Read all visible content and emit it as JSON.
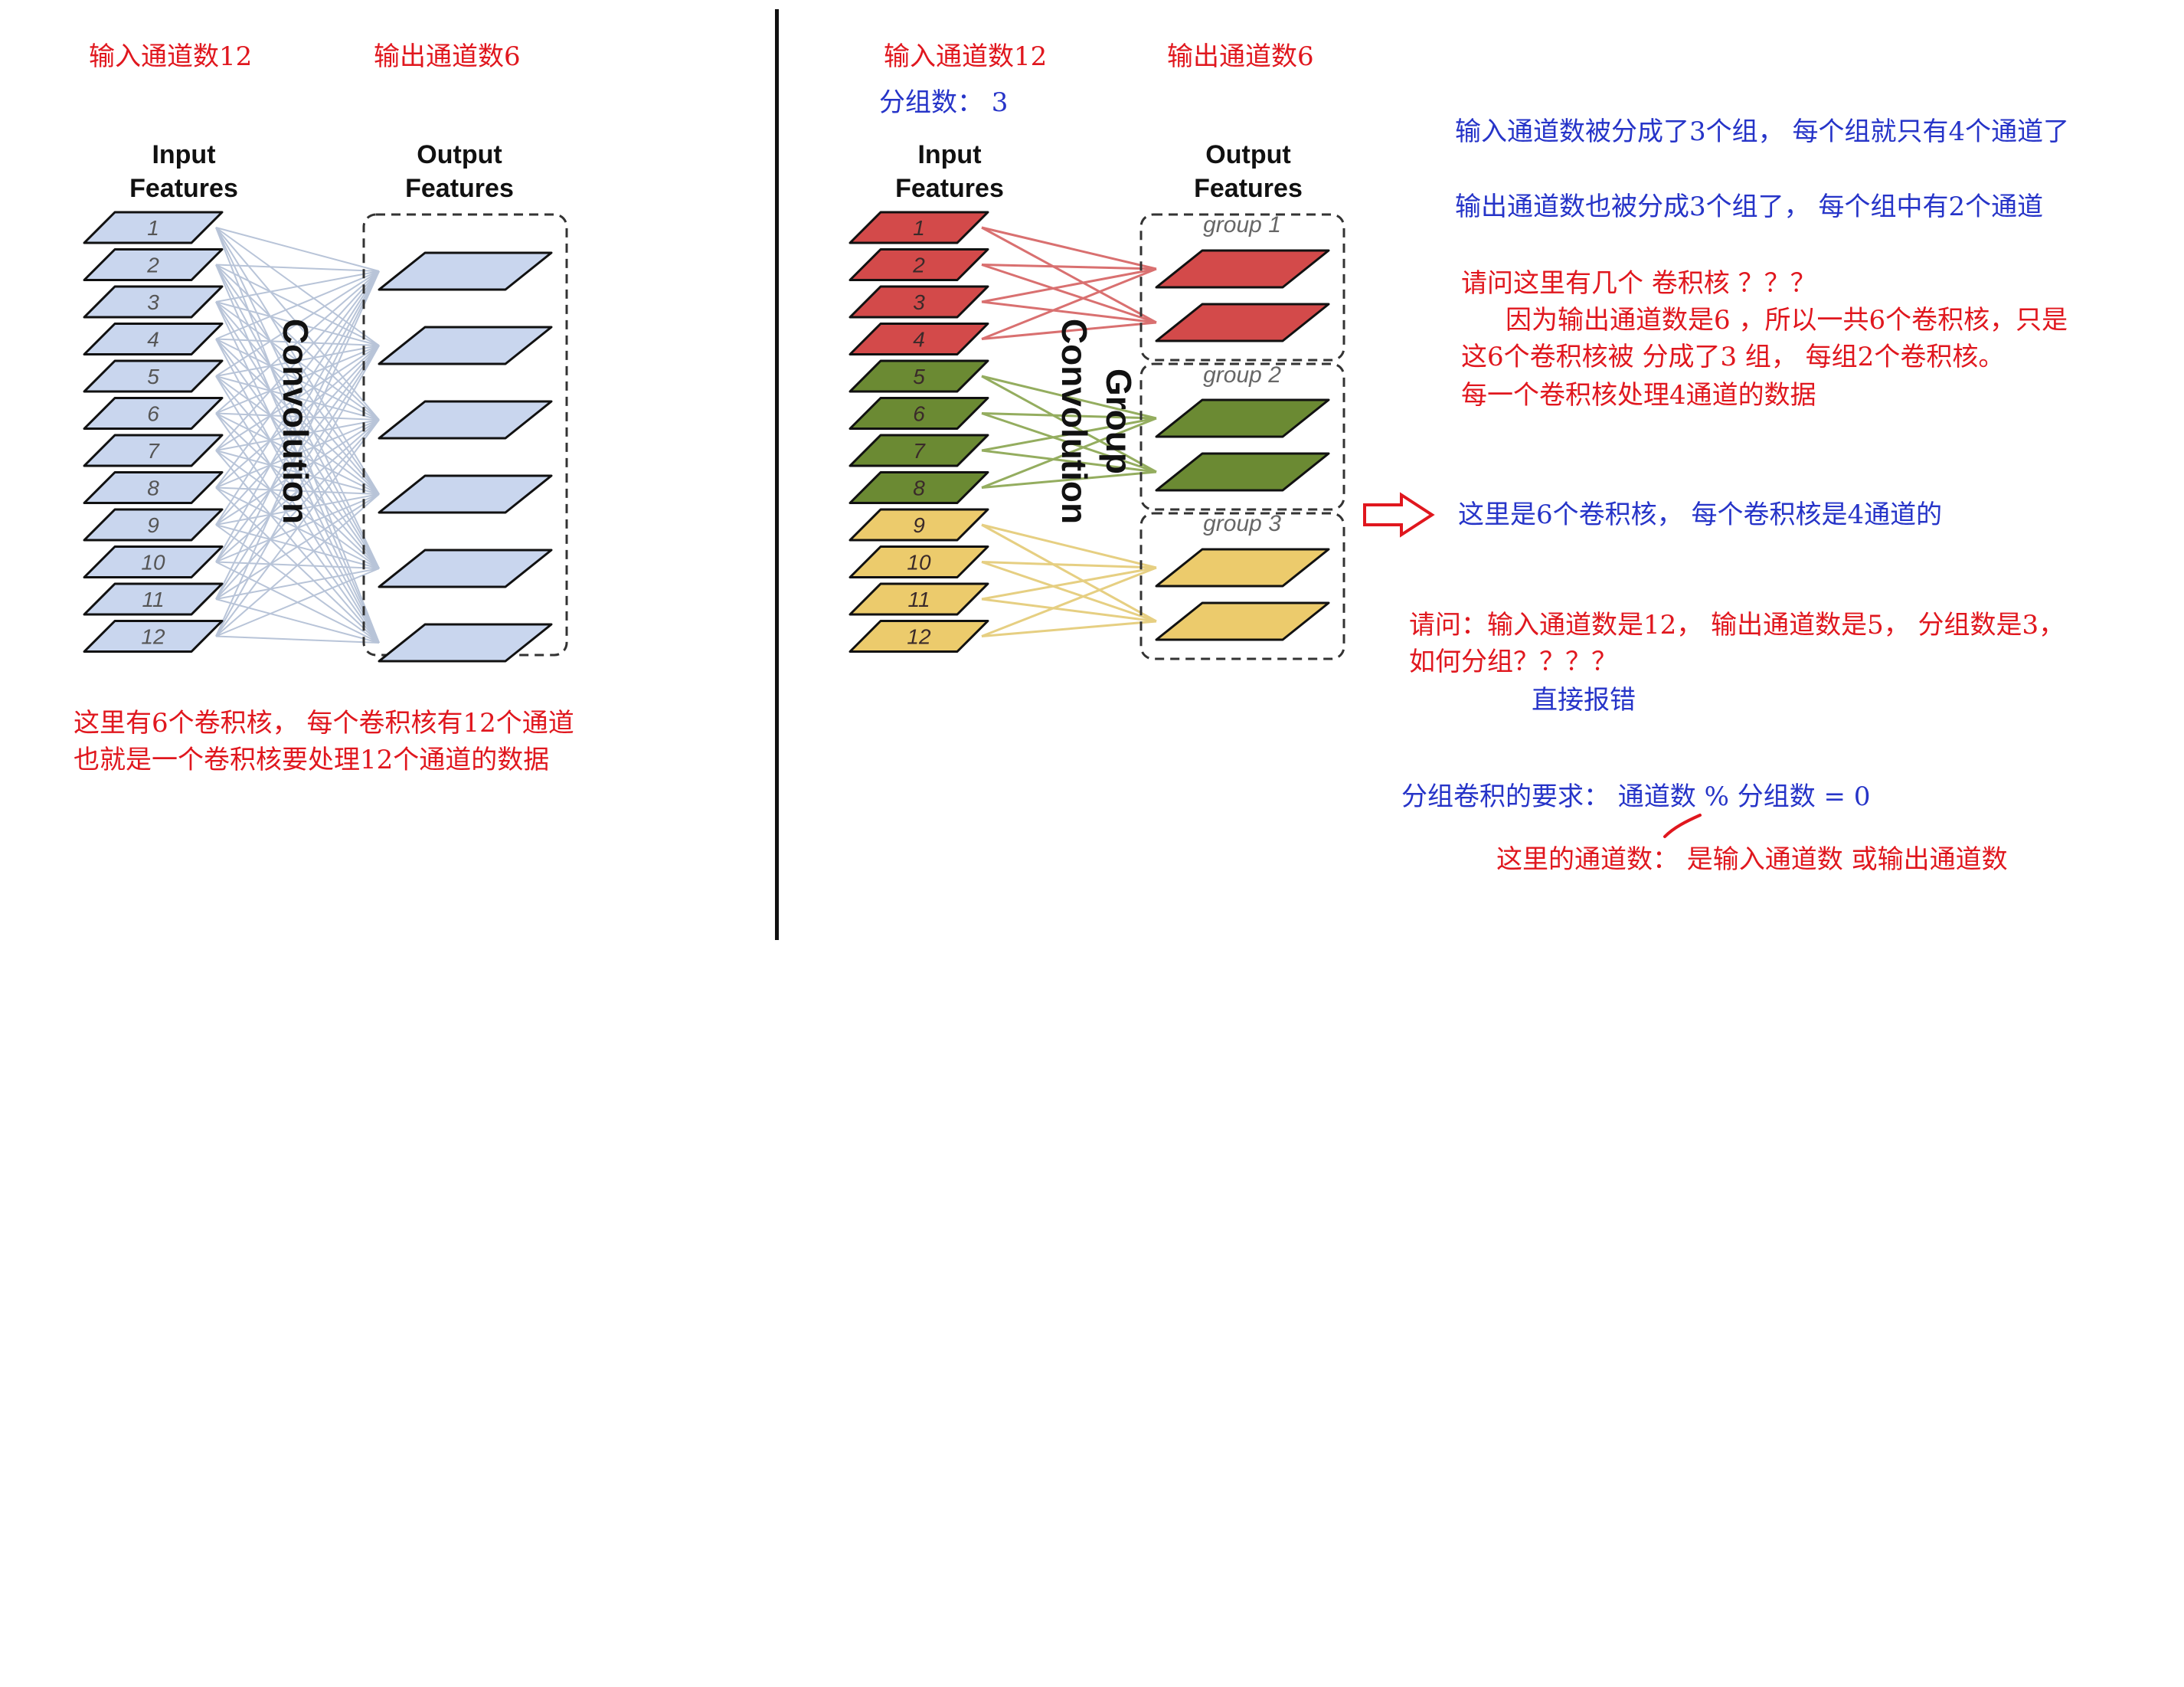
{
  "left": {
    "in_channels": "输入通道数12",
    "out_channels": "输出通道数6",
    "input_label_1": "Input",
    "input_label_2": "Features",
    "output_label_1": "Output",
    "output_label_2": "Features",
    "conv_label": "Convolution",
    "note_1": "这里有6个卷积核， 每个卷积核有12个通道",
    "note_2": "也就是一个卷积核要处理12个通道的数据"
  },
  "right": {
    "in_channels": "输入通道数12",
    "out_channels": "输出通道数6",
    "groups": "分组数： 3",
    "input_label_1": "Input",
    "input_label_2": "Features",
    "output_label_1": "Output",
    "output_label_2": "Features",
    "conv_label_1": "Group",
    "conv_label_2": "Convolution",
    "group_labels": [
      "group 1",
      "group 2",
      "group 3"
    ]
  },
  "notes": {
    "input_split": "输入通道数被分成了3个组， 每个组就只有4个通道了",
    "output_split": "输出通道数也被分成3个组了， 每个组中有2个通道",
    "question_kernels": "请问这里有几个 卷积核 ？？？",
    "answer_1": "因为输出通道数是6 ，所以一共6个卷积核，只是",
    "answer_2": "这6个卷积核被 分成了3 组， 每组2个卷积核。",
    "answer_3": "每一个卷积核处理4通道的数据",
    "arrow_note": "这里是6个卷积核， 每个卷积核是4通道的",
    "question_2a": "请问：输入通道数是12， 输出通道数是5， 分组数是3，",
    "question_2b": "如何分组？？？？",
    "answer_error": "直接报错",
    "requirement": "分组卷积的要求： 通道数 % 分组数 = 0",
    "clarify": "这里的通道数： 是输入通道数 或输出通道数"
  },
  "numbers": [
    "1",
    "2",
    "3",
    "4",
    "5",
    "6",
    "7",
    "8",
    "9",
    "10",
    "11",
    "12"
  ],
  "colors": {
    "red_text": "#e0171e",
    "blue_text": "#2634c8",
    "blue_fill": "#c9d6ee",
    "red_fill": "#d34a4a",
    "green_fill": "#6b8a33",
    "yellow_fill": "#eccb6c"
  }
}
